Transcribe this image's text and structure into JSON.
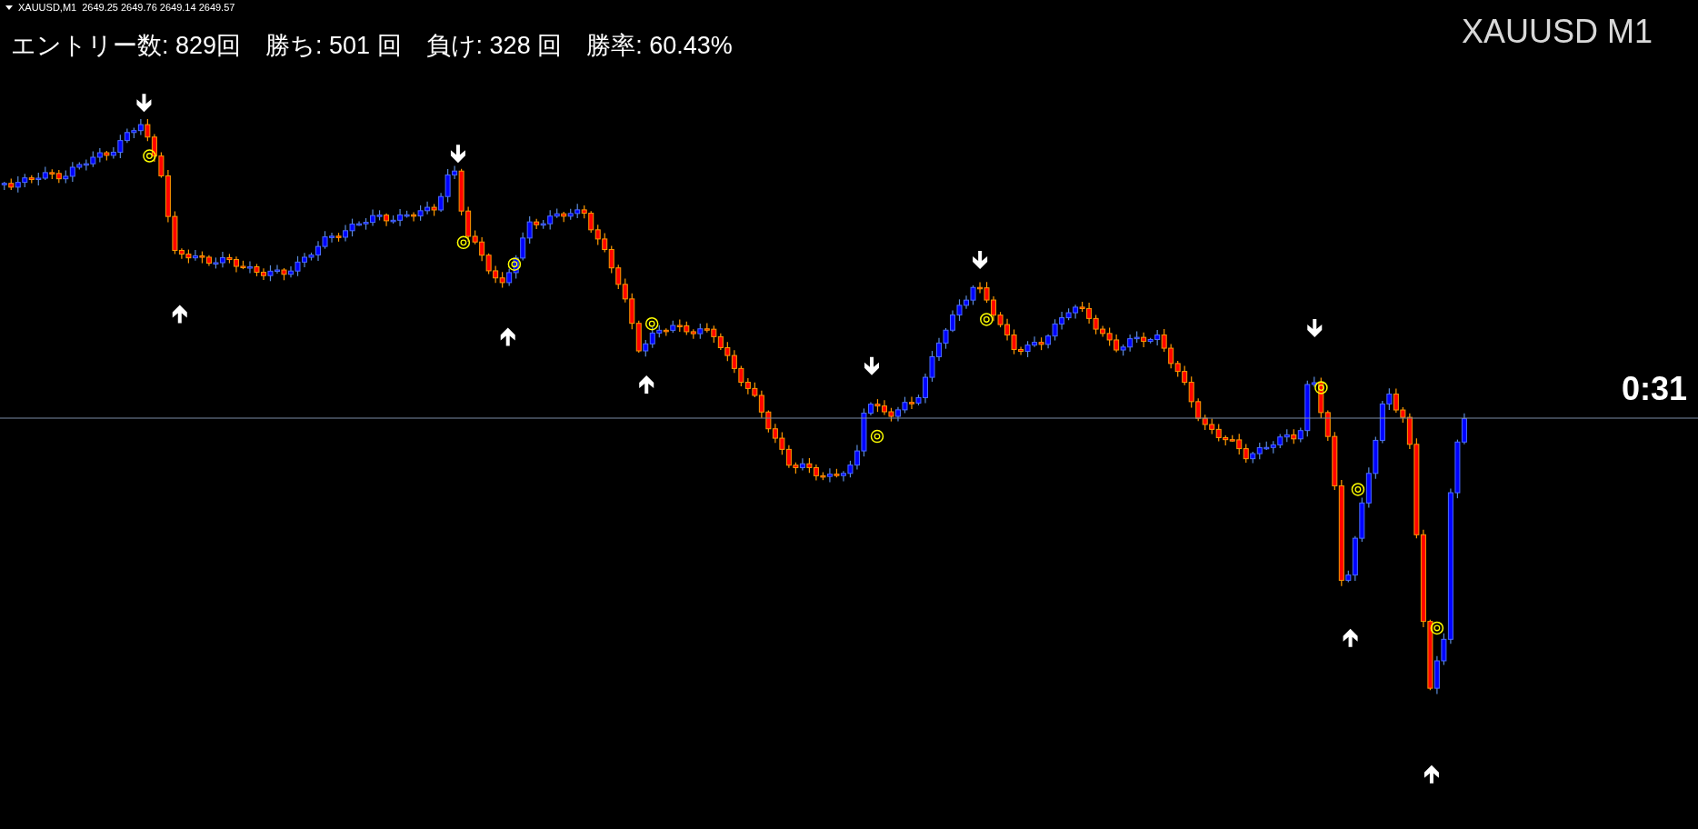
{
  "chart_header": {
    "symbol": "XAUUSD,M1",
    "prices": "2649.25 2649.76 2649.14 2649.57"
  },
  "stats": "エントリー数: 829回　勝ち: 501 回　負け: 328 回　勝率: 60.43%",
  "symbol_label": "XAUUSD M1",
  "countdown": "0:31"
}
